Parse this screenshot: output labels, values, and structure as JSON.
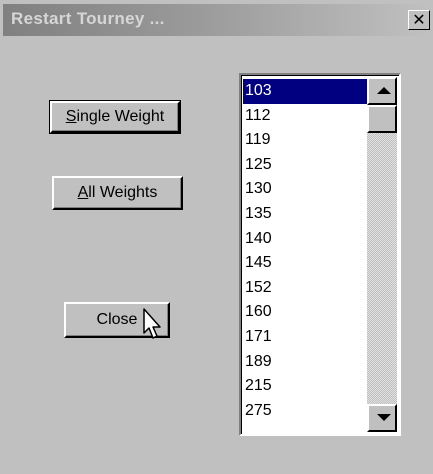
{
  "window": {
    "title": "Restart Tourney ...",
    "close_glyph": "✕"
  },
  "buttons": {
    "single_weight": {
      "mnemonic": "S",
      "rest": "ingle Weight"
    },
    "all_weights": {
      "mnemonic": "A",
      "rest": "ll Weights"
    },
    "close": "Close"
  },
  "weights_list": {
    "items": [
      "103",
      "112",
      "119",
      "125",
      "130",
      "135",
      "140",
      "145",
      "152",
      "160",
      "171",
      "189",
      "215",
      "275"
    ],
    "selected": "103",
    "selection_color": "#000080"
  },
  "icons": {
    "cursor": "mouse-pointer-icon",
    "scroll_up": "scroll-up-arrow-icon",
    "scroll_down": "scroll-down-arrow-icon"
  }
}
